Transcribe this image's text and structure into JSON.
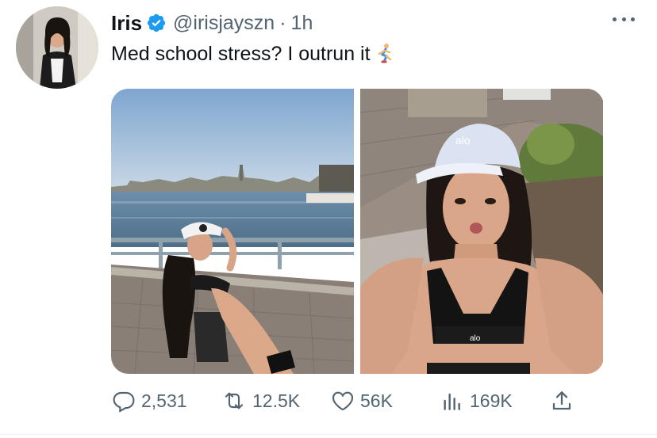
{
  "tweet": {
    "display_name": "Iris",
    "handle": "@irisjayszn",
    "separator": "·",
    "time": "1h",
    "text": "Med school stress? I outrun it",
    "emoji": "runner-emoji",
    "verified": true,
    "avatar": "profile-photo",
    "media": [
      {
        "name": "photo-waterfront",
        "description_icon": "image"
      },
      {
        "name": "photo-selfie",
        "description_icon": "image"
      }
    ]
  },
  "actions": {
    "replies": "2,531",
    "retweets": "12.5K",
    "likes": "56K",
    "views": "169K",
    "reply_icon": "reply-icon",
    "retweet_icon": "retweet-icon",
    "like_icon": "heart-icon",
    "views_icon": "views-icon",
    "share_icon": "share-icon"
  },
  "colors": {
    "text_primary": "#0f1419",
    "text_secondary": "#536471",
    "verified_blue": "#1d9bf0"
  }
}
